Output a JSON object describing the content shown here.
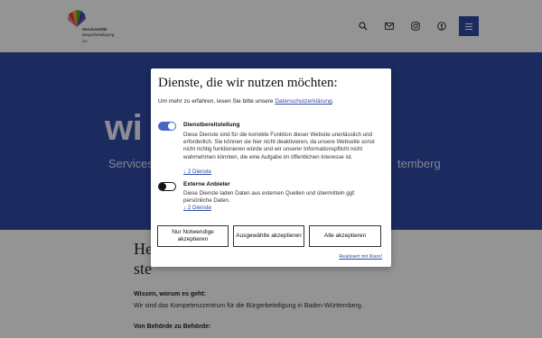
{
  "header": {
    "logo_line1": "Servicestelle",
    "logo_line2": "Bürgerbeteiligung",
    "logo_small": "BW",
    "icons": [
      "search-icon",
      "mail-icon",
      "instagram-icon",
      "podcast-icon"
    ],
    "menu_icon": "hamburger-menu-icon"
  },
  "colors": {
    "brand_blue": "#2f4aa6",
    "toggle_on": "#4a66c4",
    "link": "#2f4aa6"
  },
  "hero": {
    "title_visible": "wi                               n...",
    "subtitle_left": "Services",
    "subtitle_right": "temberg"
  },
  "content": {
    "heading_line1": "He",
    "heading_line2": "ste",
    "section1_title": "Wissen, worum es geht:",
    "section1_text": "Wir sind das Kompetenzzentrum für die Bürgerbeteiligung in Baden-Württemberg.",
    "section2_title": "Von Behörde zu Behörde:"
  },
  "consent": {
    "title": "Dienste, die wir nutzen möchten:",
    "intro_text": "Um mehr zu erfahren, lesen Sie bitte unsere",
    "intro_link": "Datenschutzerklärung",
    "intro_end": ".",
    "services": [
      {
        "name": "Dienstbereitstellung",
        "enabled": true,
        "description": "Diese Dienste sind für die korrekte Funktion dieser Website unerlässlich und erforderlich. Sie können sie hier nicht deaktivieren, da unsere Webseite sonst nicht richtig funktionieren würde und wir unserer Informationspflicht nicht wahrnehmen könnten, die eine Aufgabe im öffentlichen Interesse ist.",
        "link": "↓ 2 Dienste"
      },
      {
        "name": "Externe Anbieter",
        "enabled": false,
        "description": "Diese Dienste laden Daten aus externen Quellen und übermitteln ggf. persönliche Daten.",
        "link": "↓ 2 Dienste"
      }
    ],
    "buttons": {
      "necessary": "Nur Notwendige akzeptieren",
      "selected": "Ausgewählte akzeptieren",
      "all": "Alle akzeptieren"
    },
    "footer": "Realisiert mit Klaro!"
  }
}
